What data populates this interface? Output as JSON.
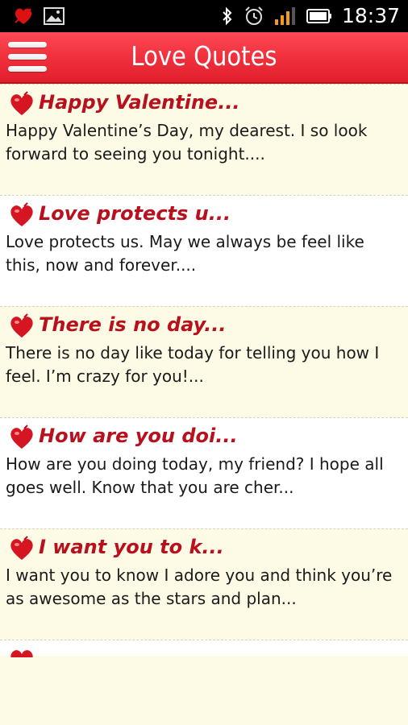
{
  "status_bar": {
    "time": "18:37",
    "left_icons": [
      "heart-app-icon",
      "image-icon"
    ],
    "right_icons": [
      "bluetooth-icon",
      "alarm-icon",
      "signal-icon",
      "battery-icon"
    ]
  },
  "app_bar": {
    "title": "Love Quotes",
    "menu_icon": "hamburger-menu-icon",
    "color": "#f2323f"
  },
  "quotes": [
    {
      "title": "Happy Valentine...",
      "body": "Happy Valentine’s Day, my dearest. I so look forward to seeing you tonight...."
    },
    {
      "title": "Love protects u...",
      "body": "Love protects us. May we always be feel like this, now and forever...."
    },
    {
      "title": "There is no day...",
      "body": "There is no day like today for telling you how I feel. I’m crazy for you!..."
    },
    {
      "title": "How are you doi...",
      "body": "How are you doing today, my friend? I hope all goes well. Know that you are cher..."
    },
    {
      "title": "I want you to k...",
      "body": "I want you to know I adore you and think you’re as awesome as the stars and plan..."
    }
  ],
  "colors": {
    "title_red": "#b8101d",
    "background": "#fdfbe6"
  }
}
